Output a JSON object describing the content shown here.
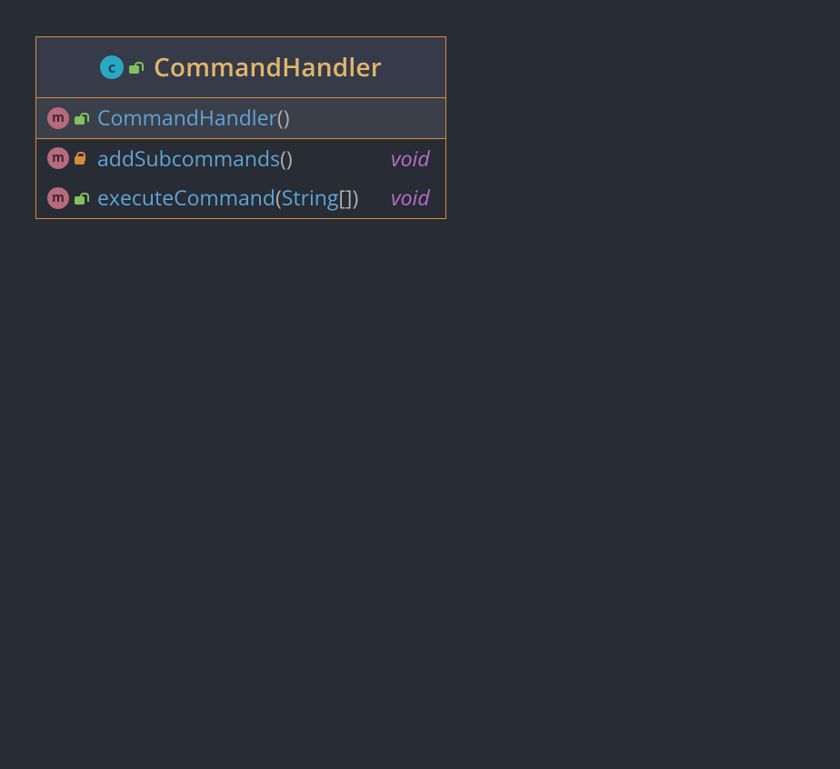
{
  "class": {
    "kind_letter": "c",
    "name": "CommandHandler",
    "visibility": "public"
  },
  "constructors": [
    {
      "kind_letter": "m",
      "visibility": "public",
      "name": "CommandHandler",
      "params_prefix": "(",
      "params_types": "",
      "params_suffix": ")",
      "return": ""
    }
  ],
  "methods": [
    {
      "kind_letter": "m",
      "visibility": "private",
      "name": "addSubcommands",
      "params_prefix": "(",
      "params_types": "",
      "params_suffix": ")",
      "return": "void"
    },
    {
      "kind_letter": "m",
      "visibility": "public",
      "name": "executeCommand",
      "params_prefix": "(",
      "params_types": "String",
      "params_array": "[]",
      "params_suffix": ")",
      "return": "void"
    }
  ]
}
